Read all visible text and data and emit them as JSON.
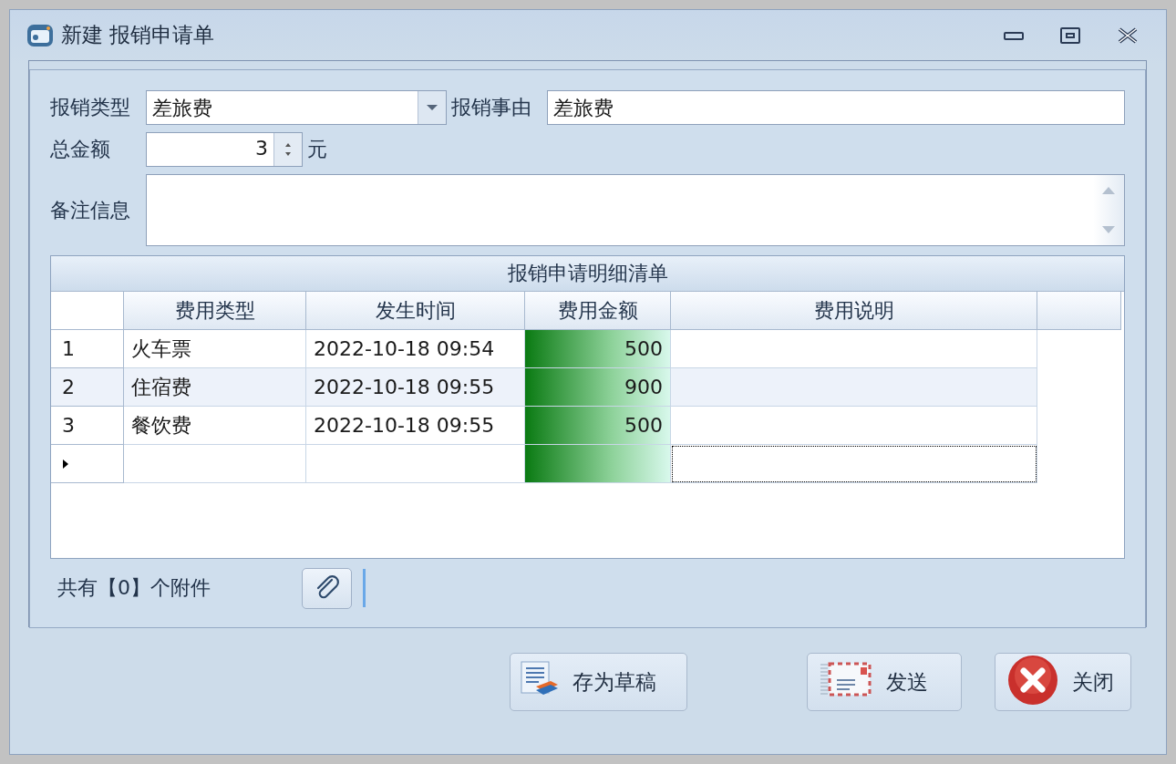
{
  "window": {
    "title": "新建 报销申请单"
  },
  "form": {
    "type_label": "报销类型",
    "type_value": "差旅费",
    "reason_label": "报销事由",
    "reason_value": "差旅费",
    "amount_label": "总金额",
    "amount_value": "3",
    "amount_unit": "元",
    "remark_label": "备注信息"
  },
  "grid": {
    "caption": "报销申请明细清单",
    "columns": [
      "费用类型",
      "发生时间",
      "费用金额",
      "费用说明"
    ],
    "rows": [
      {
        "number": "1",
        "cells": [
          "火车票",
          "2022-10-18 09:54",
          "500"
        ],
        "current": false
      },
      {
        "number": "2",
        "cells": [
          "住宿费",
          "2022-10-18 09:55",
          "900"
        ],
        "current": false
      },
      {
        "number": "3",
        "cells": [
          "餐饮费",
          "2022-10-18 09:55",
          "500"
        ],
        "current": false
      }
    ],
    "new_row": {
      "current": true
    }
  },
  "attachments": {
    "text": "共有【0】个附件"
  },
  "buttons": [
    {
      "kind": "draft",
      "label": "存为草稿"
    },
    {
      "kind": "send",
      "label": "发送"
    },
    {
      "kind": "close",
      "label": "关闭"
    }
  ]
}
